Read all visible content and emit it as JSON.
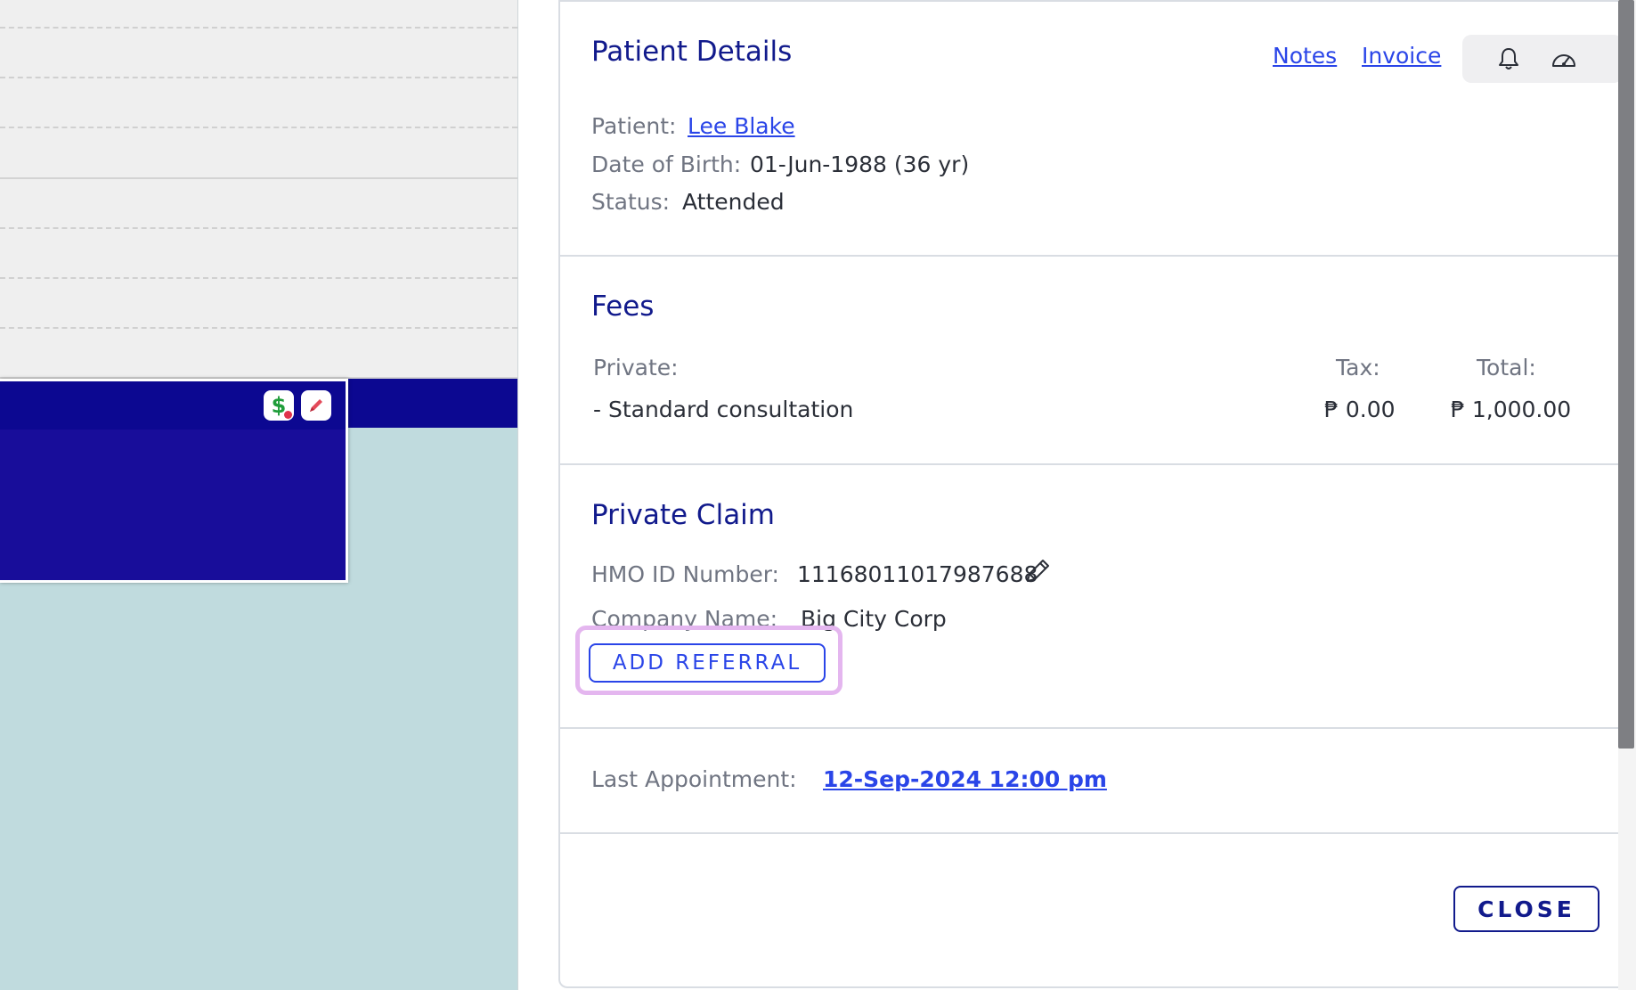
{
  "calendar": {
    "appointment_icons": [
      "dollar-icon",
      "pencil-icon"
    ],
    "dollar_symbol": "$"
  },
  "panel": {
    "patient_details": {
      "title": "Patient Details",
      "notes_link": "Notes",
      "invoice_link": "Invoice",
      "patient_label": "Patient:",
      "patient_name": "Lee Blake",
      "dob_label": "Date of Birth:",
      "dob_value": "01-Jun-1988 (36 yr)",
      "status_label": "Status:",
      "status_value": "Attended"
    },
    "fees": {
      "title": "Fees",
      "private_label": "Private:",
      "tax_header": "Tax:",
      "total_header": "Total:",
      "item_name": "- Standard consultation",
      "item_tax": "₱ 0.00",
      "item_total": "₱ 1,000.00"
    },
    "private_claim": {
      "title": "Private Claim",
      "hmo_label": "HMO ID Number:",
      "hmo_value": "11168011017987688",
      "company_label": "Company Name:",
      "company_value": "Big City Corp",
      "add_referral_label": "ADD REFERRAL"
    },
    "last_appointment": {
      "label": "Last Appointment:",
      "value": "12-Sep-2024 12:00 pm"
    },
    "close_label": "CLOSE"
  },
  "colors": {
    "navy": "#111a8c",
    "link": "#2a45e8",
    "highlight": "#e4b6ef",
    "calendar_bg": "#c0dbde",
    "appointment": "#180d9a"
  }
}
